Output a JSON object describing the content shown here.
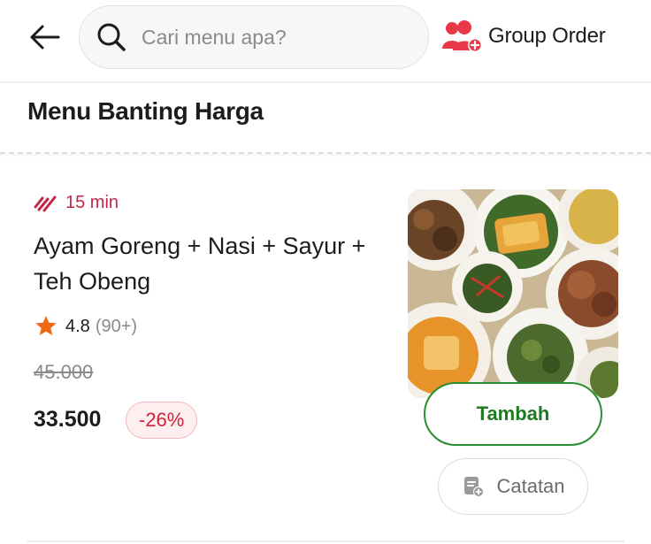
{
  "header": {
    "search": {
      "placeholder": "Cari menu apa?",
      "value": ""
    },
    "group_order_label": "Group Order",
    "icons": {
      "back": "arrow-left-icon",
      "search": "search-icon",
      "group_order": "group-add-icon"
    }
  },
  "section": {
    "title": "Menu Banting Harga"
  },
  "item": {
    "eta": "15 min",
    "name": "Ayam Goreng + Nasi + Sayur + Teh Obeng",
    "rating": "4.8",
    "rating_count": "(90+)",
    "original_price": "45.000",
    "price": "33.500",
    "discount": "-26%",
    "add_label": "Tambah",
    "note_label": "Catatan",
    "image": "food-photo"
  },
  "colors": {
    "accent_green": "#1f7a23",
    "discount_red": "#d0213a",
    "eta_red": "#c4264a",
    "star_orange": "#ee6a12",
    "group_icon_red": "#e8394a"
  }
}
